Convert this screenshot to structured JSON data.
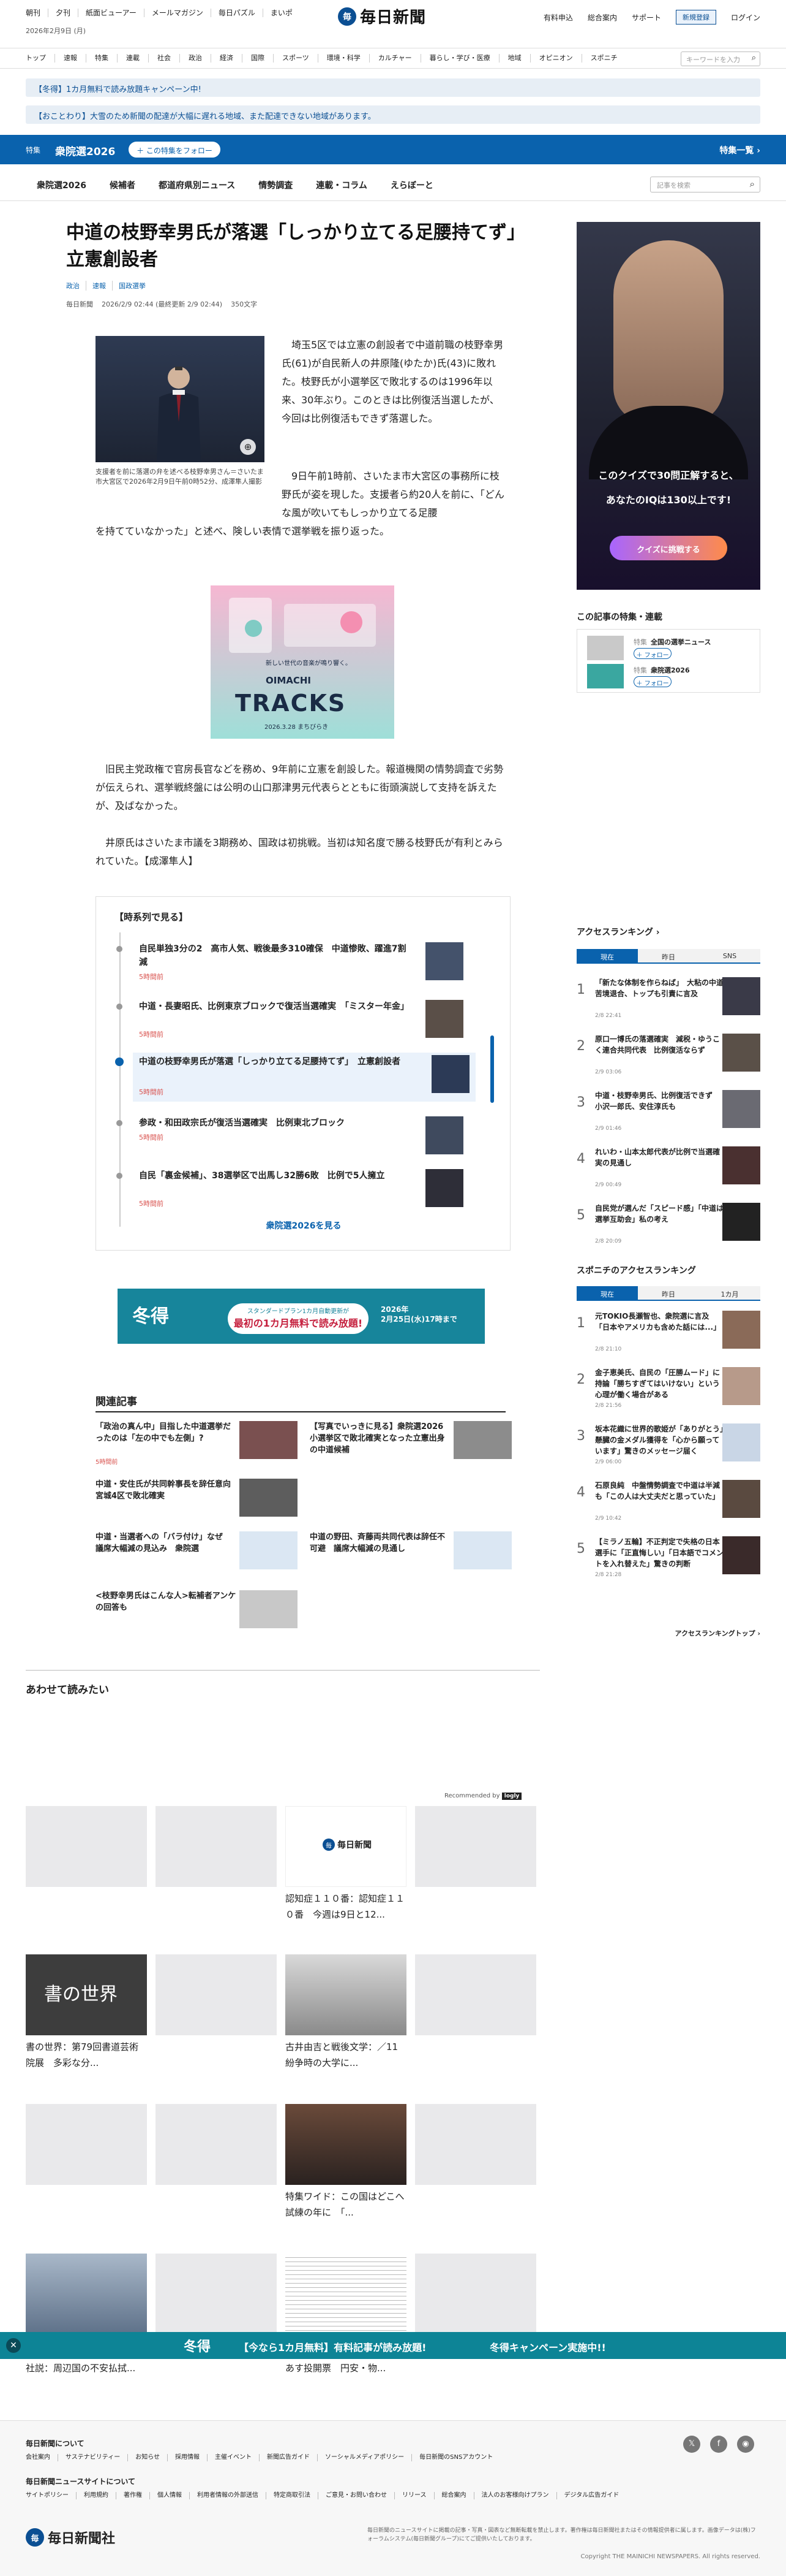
{
  "header": {
    "toplinks": [
      "朝刊",
      "夕刊",
      "紙面ビューアー",
      "メールマガジン",
      "毎日パズル",
      "まいポ"
    ],
    "date": "2026年2月9日 (月)",
    "logo_mark": "毎",
    "logo_text": "毎日新聞",
    "util": [
      "有料申込",
      "総合案内",
      "サポート"
    ],
    "register": "新規登録",
    "login": "ログイン"
  },
  "catnav": {
    "items": [
      "トップ",
      "速報",
      "特集",
      "連載",
      "社会",
      "政治",
      "経済",
      "国際",
      "スポーツ",
      "環境・科学",
      "カルチャー",
      "暮らし・学び・医療",
      "地域",
      "オピニオン",
      "スポニチ"
    ],
    "keyword_placeholder": "キーワードを入力"
  },
  "notices": [
    "【冬得】1カ月無料で読み放題キャンペーン中!",
    "【おことわり】大雪のため新聞の配達が大幅に遅れる地域、また配達できない地域があります。"
  ],
  "feature": {
    "tag": "特集",
    "title": "衆院選2026",
    "follow": "＋ この特集をフォロー",
    "list": "特集一覧 ›"
  },
  "subnav": {
    "items": [
      "衆院選2026",
      "候補者",
      "都道府県別ニュース",
      "情勢調査",
      "連載・コラム",
      "えらぼーと"
    ],
    "search_placeholder": "記事を検索"
  },
  "article": {
    "headline": "中道の枝野幸男氏が落選「しっかり立てる足腰持てず」　立憲創設者",
    "tags": [
      "政治",
      "速報",
      "国政選挙"
    ],
    "source": "毎日新聞",
    "datetime": "2026/2/9 02:44 (最終更新 2/9 02:44)",
    "chars": "350文字",
    "caption": "支援者を前に落選の弁を述べる枝野幸男さん＝さいたま市大宮区で2026年2月9日午前0時52分、成澤隼人撮影",
    "p1": "　埼玉5区では立憲の創設者で中道前職の枝野幸男氏(61)が自民新人の井原隆(ゆたか)氏(43)に敗れた。枝野氏が小選挙区で敗北するのは1996年以来、30年ぶり。このときは比例復活当選したが、今回は比例復活もできず落選した。",
    "p2": "　9日午前1時前、さいたま市大宮区の事務所に枝野氏が姿を現した。支援者ら約20人を前に、「どんな風が吹いてもしっかり立てる足腰を持てていなかった」と述べ、険しい表情で選挙戦を振り返った。",
    "p3": "　旧民主党政権で官房長官などを務め、9年前に立憲を創設した。報道機関の情勢調査で劣勢が伝えられ、選挙戦終盤には公明の山口那津男元代表らとともに街頭演説して支持を訴えたが、及ばなかった。",
    "p4": "　井原氏はさいたま市議を3期務め、国政は初挑戦。当初は知名度で勝る枝野氏が有利とみられていた。【成澤隼人】",
    "ad_small": "新しい世代の音楽が鳴り響く。",
    "ad_title": "TRACKS",
    "ad_brand": "OIMACHI",
    "ad_date": "2026.3.28 まちびらき"
  },
  "timeline": {
    "heading": "【時系列で見る】",
    "items": [
      {
        "text": "自民単独3分の2　高市人気、戦後最多310確保　中道惨敗、躍進7割減",
        "time": "5時間前"
      },
      {
        "text": "中道・長妻昭氏、比例東京ブロックで復活当選確実　「ミスター年金」",
        "time": "5時間前"
      },
      {
        "text": "中道の枝野幸男氏が落選「しっかり立てる足腰持てず」　立憲創設者",
        "time": "5時間前"
      },
      {
        "text": "参政・和田政宗氏が復活当選確実　比例東北ブロック",
        "time": "5時間前"
      },
      {
        "text": "自民「裏金候補」、38選挙区で出馬し32勝6敗　比例で5人擁立",
        "time": "5時間前"
      }
    ],
    "more": "衆院選2026を見る"
  },
  "banner": {
    "fuyu": "冬得",
    "line1": "スタンダードプラン1カ月自動更新が",
    "line2": "最初の1カ月無料で読み放題!",
    "right1": "2026年",
    "right2": "2月25日(水)17時まで"
  },
  "related": {
    "heading": "関連記事",
    "items": [
      {
        "text": "「政治の真ん中」目指した中道選挙だったのは「左の中でも左側」?",
        "time": "5時間前"
      },
      {
        "text": "【写真でいっきに見る】衆院選2026　小選挙区で敗北確実となった立憲出身の中道候補",
        "time": ""
      },
      {
        "text": "中道・安住氏が共同幹事長を辞任意向　宮城4区で敗北確実",
        "time": ""
      },
      {
        "text": "中道・当選者への「バラ付け」なぜ　議席大幅減の見込み　衆院選",
        "time": ""
      },
      {
        "text": "中道の野田、斉藤両共同代表は辞任不可避　議席大幅減の見通し",
        "time": ""
      },
      {
        "text": "<枝野幸男氏はこんな人>転補者アンケの回答も",
        "time": ""
      }
    ]
  },
  "awase": {
    "heading": "あわせて読みたい",
    "recommended_by": "Recommended by",
    "rec_brand": "logly",
    "items": [
      {
        "text": "認知症１１０番：認知症１１０番　今週は9日と12..."
      },
      {
        "text": "書の世界：第79回書道芸術院展　多彩な分..."
      },
      {
        "text": "古井由吉と戦後文学：／11　紛争時の大学に..."
      },
      {
        "text": "特集ワイド：この国はどこへ　試練の年に　「..."
      },
      {
        "text": "社説：周辺国の不安払拭..."
      },
      {
        "text": "あす投開票　円安・物..."
      }
    ]
  },
  "sidebar": {
    "ad_line1": "このクイズで30問正解すると、",
    "ad_line2": "あなたのIQは130以上です!",
    "ad_cta": "クイズに挑戦する",
    "topics_heading": "この記事の特集・連載",
    "topics": [
      {
        "s": "特集",
        "name": "全国の選挙ニュース",
        "follow": "＋ フォロー"
      },
      {
        "s": "特集",
        "name": "衆院選2026",
        "follow": "＋ フォロー"
      }
    ],
    "ranking_heading": "アクセスランキング ›",
    "tabs": [
      "現在",
      "昨日",
      "SNS"
    ],
    "ranking": [
      {
        "text": "「新たな体制を作らねば」　大粘の中道苦境退合、トップも引責に言及",
        "time": "2/8 22:41"
      },
      {
        "text": "原口一博氏の落選確実　減税・ゆうこく連合共同代表　比例復活ならず",
        "time": "2/9 03:06"
      },
      {
        "text": "中道・枝野幸男氏、比例復活できず　小沢一郎氏、安住淳氏も",
        "time": "2/9 01:46"
      },
      {
        "text": "れいわ・山本太郎代表が比例で当選確実の見通し",
        "time": "2/9 00:49"
      },
      {
        "text": "自民党が選んだ「スピード感」「中道は選挙互助会」私の考え",
        "time": "2/8 20:09"
      }
    ],
    "spo_heading": "スポニチのアクセスランキング",
    "spo_tabs": [
      "現在",
      "昨日",
      "1カ月"
    ],
    "spo_ranking": [
      {
        "text": "元TOKIO長瀬智也、衆院選に言及「日本やアメリカも含めた話には...」",
        "time": "2/8 21:10"
      },
      {
        "text": "金子恵美氏、自民の「圧勝ムード」に持論「勝ちすぎてはいけない」という心理が働く場合がある",
        "time": "2/8 21:56"
      },
      {
        "text": "坂本花織に世界的歌姫が「ありがとう」　懸臓の金メダル獲得を「心から願っています」驚きのメッセージ届く",
        "time": "2/9 06:00"
      },
      {
        "text": "石原良純　中盤情勢調査で中道は半減も「この人は大丈夫だと思っていた」",
        "time": "2/9 10:42"
      },
      {
        "text": "【ミラノ五輪】不正判定で失格の日本選手に「正直悔しい」「日本語でコメントを入れ替えた」驚きの判断",
        "time": "2/8 21:28"
      }
    ],
    "spo_more": "アクセスランキングトップ ›"
  },
  "sticky": {
    "fuyu": "冬得",
    "middle": "【今なら1カ月無料】有料記事が読み放題!",
    "right": "冬得キャンペーン実施中!!"
  },
  "footer": {
    "h1": "毎日新聞について",
    "links1": [
      "会社案内",
      "サステナビリティー",
      "お知らせ",
      "採用情報",
      "主催イベント",
      "新聞広告ガイド",
      "ソーシャルメディアポリシー",
      "毎日新聞のSNSアカウント"
    ],
    "h2": "毎日新聞ニュースサイトについて",
    "links2": [
      "サイトポリシー",
      "利用規約",
      "著作権",
      "個人情報",
      "利用者情報の外部送信",
      "特定商取引法",
      "ご意見・お問い合わせ",
      "リリース",
      "総合案内",
      "法人のお客様向けプラン",
      "デジタル広告ガイド"
    ],
    "logo_text": "毎日新聞社",
    "note": "毎日新聞のニュースサイトに掲載の記事・写真・図表など無断転載を禁止します。著作権は毎日新聞社またはその情報提供者に属します。画像データは(株)フォーラムシステム(毎日新聞グループ)にてご提供いたしております。",
    "copy": "Copyright THE MAINICHI NEWSPAPERS. All rights reserved."
  }
}
